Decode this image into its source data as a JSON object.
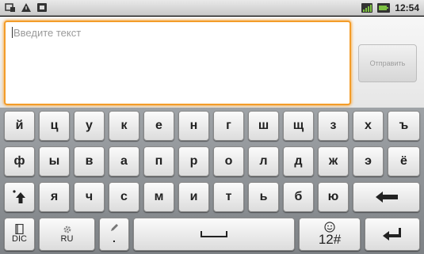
{
  "status_bar": {
    "time": "12:54",
    "left_icons": [
      "usb-debug-icon",
      "warning-icon",
      "android-notify-icon"
    ],
    "right_icons": [
      "signal-icon",
      "battery-icon"
    ]
  },
  "compose": {
    "placeholder": "Введите текст",
    "send_label": "Отправить"
  },
  "keyboard": {
    "row1": [
      "й",
      "ц",
      "у",
      "к",
      "е",
      "н",
      "г",
      "ш",
      "щ",
      "з",
      "х",
      "ъ"
    ],
    "row2": [
      "ф",
      "ы",
      "в",
      "а",
      "п",
      "р",
      "о",
      "л",
      "д",
      "ж",
      "э",
      "ё"
    ],
    "row3": [
      "я",
      "ч",
      "с",
      "м",
      "и",
      "т",
      "ь",
      "б",
      "ю"
    ],
    "dic_label": "DIC",
    "lang_label": "RU",
    "punct_label": ".",
    "num_label": "12#",
    "accent": "#f39c2a"
  }
}
